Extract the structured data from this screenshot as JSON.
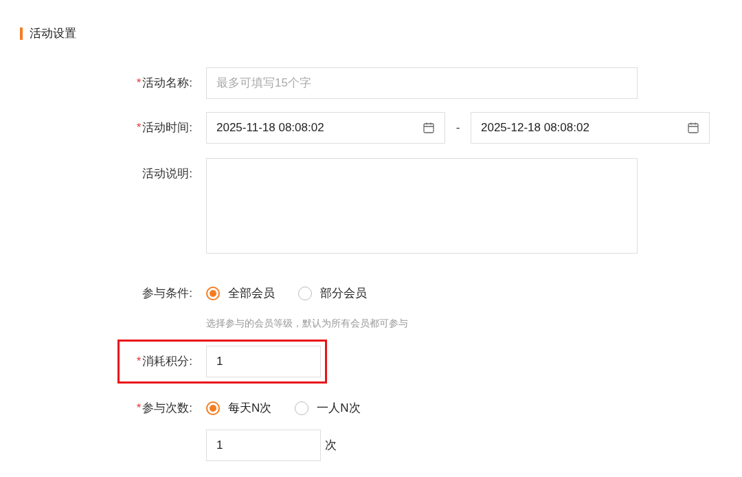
{
  "section_title": "活动设置",
  "fields": [
    {
      "kind": "text",
      "label": "活动名称:",
      "required_mark": "*",
      "placeholder": "最多可填写15个字"
    },
    {
      "kind": "daterange",
      "label": "活动时间:",
      "required_mark": "*",
      "start": "2025-11-18 08:08:02",
      "separator": "-",
      "end": "2025-12-18 08:08:02"
    },
    {
      "kind": "textarea",
      "label": "活动说明:"
    },
    {
      "kind": "radio",
      "label": "参与条件:",
      "options": [
        {
          "label": "全部会员",
          "selected": true
        },
        {
          "label": "部分会员",
          "selected": false
        }
      ],
      "hint": "选择参与的会员等级，默认为所有会员都可参与"
    },
    {
      "kind": "number",
      "label": "消耗积分:",
      "required_mark": "*",
      "value": "1",
      "highlighted": true
    },
    {
      "kind": "radio",
      "label": "参与次数:",
      "required_mark": "*",
      "options": [
        {
          "label": "每天N次",
          "selected": true
        },
        {
          "label": "一人N次",
          "selected": false
        }
      ]
    },
    {
      "kind": "number",
      "value": "1",
      "unit": "次",
      "highlighted": false
    }
  ]
}
